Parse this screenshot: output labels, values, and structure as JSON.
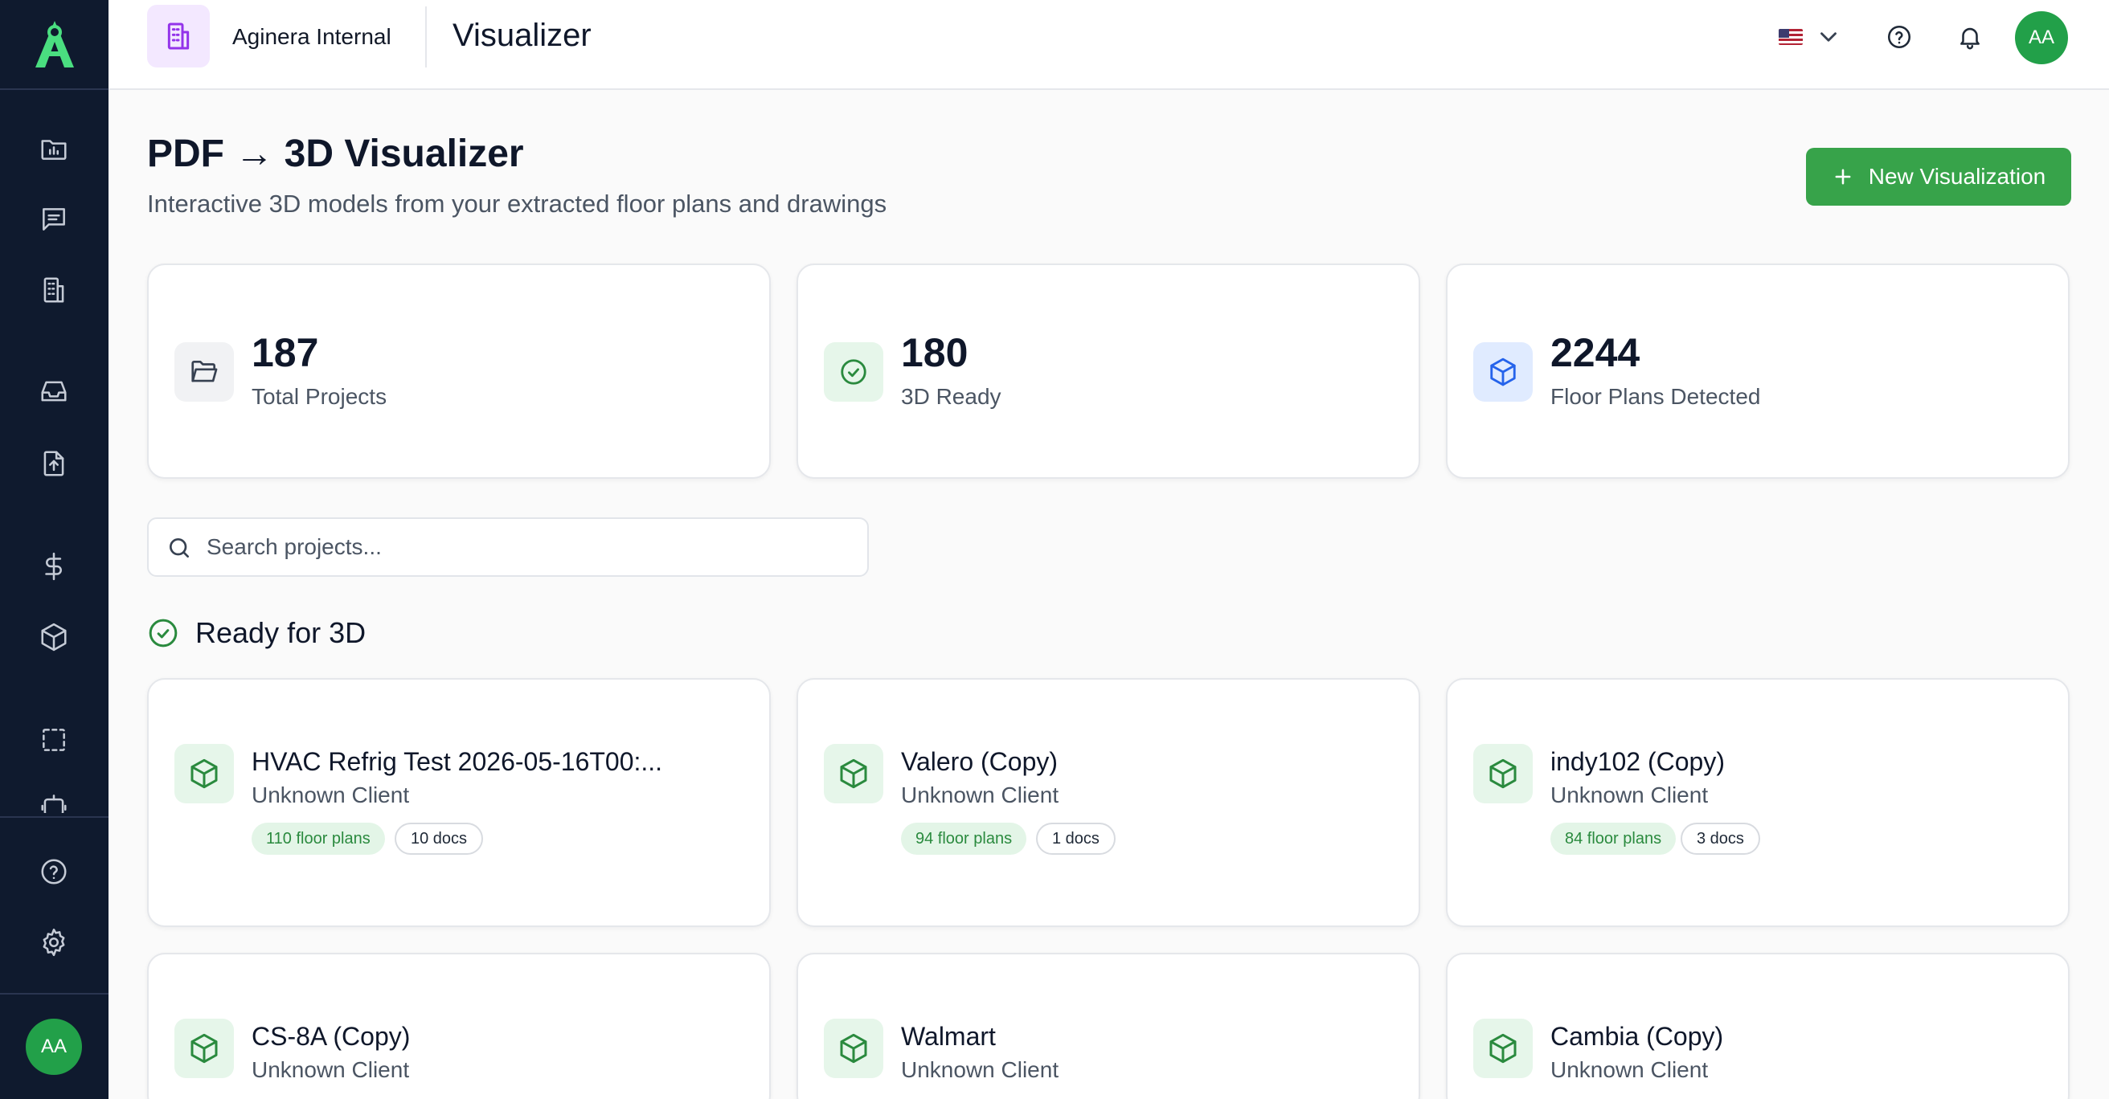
{
  "header": {
    "org_name": "Aginera Internal",
    "page_name": "Visualizer",
    "avatar_initials": "AA"
  },
  "sidebar": {
    "avatar_initials": "AA",
    "icons": [
      "presentation-icon",
      "message-icon",
      "building-icon",
      "inbox-icon",
      "file-upload-icon",
      "dollar-icon",
      "cube-icon",
      "selection-icon",
      "robot-icon",
      "help-icon",
      "settings-icon"
    ]
  },
  "page": {
    "title": "PDF → 3D Visualizer",
    "subtitle": "Interactive 3D models from your extracted floor plans and drawings",
    "new_button_label": "New Visualization"
  },
  "stats": [
    {
      "value": "187",
      "label": "Total Projects",
      "icon": "folder-icon"
    },
    {
      "value": "180",
      "label": "3D Ready",
      "icon": "check-circle-icon"
    },
    {
      "value": "2244",
      "label": "Floor Plans Detected",
      "icon": "cube-icon"
    }
  ],
  "search": {
    "placeholder": "Search projects..."
  },
  "section": {
    "title": "Ready for 3D"
  },
  "projects": [
    {
      "name": "HVAC Refrig Test 2026-05-16T00:...",
      "client": "Unknown Client",
      "floor_plans": "110 floor plans",
      "docs": "10 docs"
    },
    {
      "name": "Valero (Copy)",
      "client": "Unknown Client",
      "floor_plans": "94 floor plans",
      "docs": "1 docs"
    },
    {
      "name": "indy102 (Copy)",
      "client": "Unknown Client",
      "floor_plans": "84 floor plans",
      "docs": "3 docs"
    },
    {
      "name": "CS-8A (Copy)",
      "client": "Unknown Client"
    },
    {
      "name": "Walmart",
      "client": "Unknown Client"
    },
    {
      "name": "Cambia (Copy)",
      "client": "Unknown Client"
    }
  ],
  "colors": {
    "sidebar_bg": "#0f1a2e",
    "accent_green": "#37a34a",
    "avatar_green": "#22a049",
    "org_badge_purple": "#9333ea",
    "cube_blue": "#2563eb"
  }
}
